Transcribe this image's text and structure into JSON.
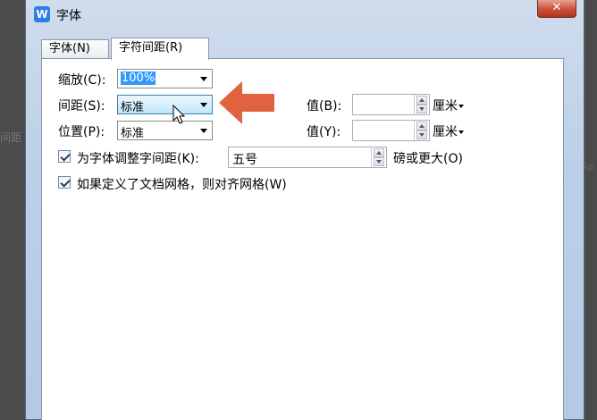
{
  "window": {
    "title": "字体",
    "app_icon": "W",
    "close_label": "✕"
  },
  "tabs": [
    {
      "label": "字体(N)"
    },
    {
      "label": "字符间距(R)"
    }
  ],
  "scale": {
    "label": "缩放(C):",
    "value": "100%"
  },
  "spacing": {
    "label": "间距(S):",
    "value": "标准",
    "by_label": "值(B):",
    "by_value": "",
    "unit": "厘米"
  },
  "position": {
    "label": "位置(P):",
    "value": "标准",
    "by_label": "值(Y):",
    "by_value": "",
    "unit": "厘米"
  },
  "kerning": {
    "label": "为字体调整字间距(K):",
    "checked": true,
    "value": "五号",
    "suffix": "磅或更大(O)"
  },
  "grid": {
    "label": "如果定义了文档网格，则对齐网格(W)",
    "checked": true
  },
  "backdrop": {
    "left_text": "间距",
    "right_text": "Aa"
  },
  "colors": {
    "annotation_arrow": "#e0623f",
    "selection": "#3399ff"
  }
}
